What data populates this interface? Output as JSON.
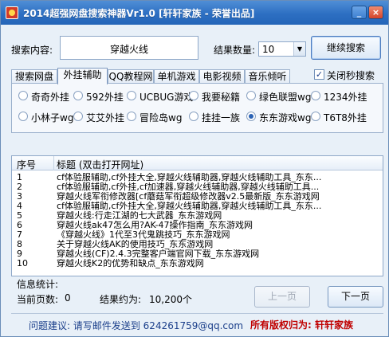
{
  "window": {
    "title": "2014超强网盘搜索神器Vr1.0 [轩轩家族 - 荣誉出品]",
    "minimize_label": "_",
    "close_label": "×"
  },
  "search": {
    "label": "搜索内容:",
    "query": "穿越火线",
    "count_label": "结果数量:",
    "count_value": "10",
    "continue_button": "继续搜索"
  },
  "tabs": [
    {
      "label": "搜索网盘"
    },
    {
      "label": "外挂辅助",
      "active": true
    },
    {
      "label": "QQ教程网"
    },
    {
      "label": "单机游戏"
    },
    {
      "label": "电影视频"
    },
    {
      "label": "音乐倾听"
    }
  ],
  "close_instant_search": {
    "label": "关闭秒搜索",
    "checked": true
  },
  "sites": [
    {
      "label": "奇奇外挂"
    },
    {
      "label": "592外挂"
    },
    {
      "label": "UCBUG游戏"
    },
    {
      "label": "我要秘籍"
    },
    {
      "label": "绿色联盟wg"
    },
    {
      "label": "1234外挂"
    },
    {
      "label": "小林子wg"
    },
    {
      "label": "艾艾外挂"
    },
    {
      "label": "冒险岛wg"
    },
    {
      "label": "挂挂一族"
    },
    {
      "label": "东东游戏wg",
      "selected": true
    },
    {
      "label": "T6T8外挂"
    }
  ],
  "results": {
    "col_number": "序号",
    "col_title": "标题 (双击打开网址)",
    "rows": [
      {
        "no": "1",
        "title": "cf体验服辅助,cf外挂大全,穿越火线辅助器,穿越火线辅助工具_东东..."
      },
      {
        "no": "2",
        "title": "cf体验服辅助,cf外挂,cf加速器,穿越火线辅助器,穿越火线辅助工具..."
      },
      {
        "no": "3",
        "title": "穿越火线军衔修改器[cf蘑菇军衔超级修改器v2.5最新版_东东游戏网"
      },
      {
        "no": "4",
        "title": "cf体验服辅助,cf外挂大全,穿越火线辅助器,穿越火线辅助工具_东东..."
      },
      {
        "no": "5",
        "title": "穿越火线:行走江湖的七大武器_东东游戏网"
      },
      {
        "no": "6",
        "title": "穿越火线ak47怎么用?AK-47操作指南_东东游戏网"
      },
      {
        "no": "7",
        "title": "《穿越火线》1代至3代鬼跳技巧_东东游戏网"
      },
      {
        "no": "8",
        "title": "关于穿越火线AK的使用技巧_东东游戏网"
      },
      {
        "no": "9",
        "title": "穿越火线(CF)2.4.3完整客户端官网下载_东东游戏网"
      },
      {
        "no": "10",
        "title": "穿越火线K2的优势和缺点_东东游戏网"
      }
    ]
  },
  "stats": {
    "label": "信息统计:",
    "current_page_label": "当前页数:",
    "current_page": "0",
    "results_label": "结果约为:",
    "results_count": "10,200个"
  },
  "pager": {
    "prev": "上一页",
    "next": "下一页"
  },
  "footer": {
    "left": "问题建议: 请写邮件发送到 624261759@qq.com",
    "right": "所有版权归为: 轩轩家族"
  },
  "colors": {
    "title_bar": "#2d6fc2",
    "footer_right": "#c00000",
    "footer_left": "#1a3e8a"
  }
}
